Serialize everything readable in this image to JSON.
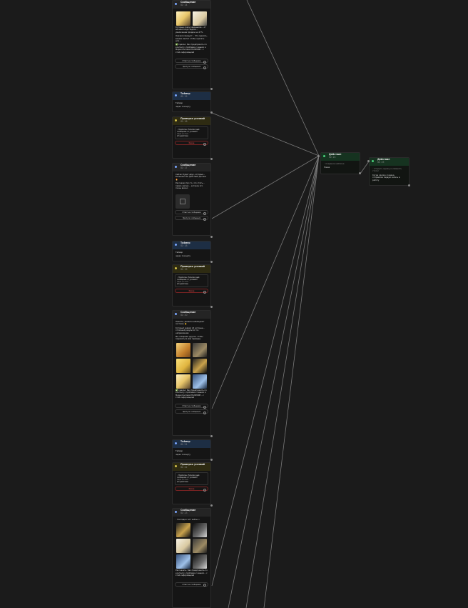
{
  "nodes": {
    "msg1": {
      "title": "Сообщение",
      "subtitle": "ID: 14",
      "text_a": "Которые сразу разрешили... от абонентов до задачи... увеличение продаж на 27%",
      "text_b": "Оказали продукт... Что сделать, вашим хватит чтобы сделать для...",
      "text_c": "✅ Сделал, Как предпринять по контенту, проблема с вашим и Маркетинговой НАЛИЧИЕ... с этой информацией",
      "btn1": "Ответ на сообщение",
      "btn2": "Пропуск сообщения"
    },
    "wait1": {
      "title": "Таймер",
      "subtitle": "ID: 15",
      "line1": "Таймер",
      "line2": "через 1 минуту"
    },
    "cond1": {
      "title": "Проверка условий",
      "subtitle": "ID: 16",
      "q": "◦ Подписан. Написал ещё сообщение от условий?",
      "sub": "Одна из этих",
      "v1": "2/1",
      "v2": "действие",
      "else": "Иначе"
    },
    "msg2": {
      "title": "Сообщение",
      "subtitle": "ID: 17",
      "text_a": "Сейчас будет двух, которые... большинство действий для вас 🔥",
      "text_b": "Рассказал про то, что стать... прямо сейчас... которое это очень важно",
      "btn1": "Ответ на сообщение",
      "btn2": "Пропуск сообщения"
    },
    "wait2": {
      "title": "Таймер",
      "subtitle": "ID: 18",
      "line1": "Таймер",
      "line2": "через 1 минуту"
    },
    "cond2": {
      "title": "Проверка условий",
      "subtitle": "ID: 19",
      "q": "◦ Подписан. Написал ещё сообщение от условий?",
      "sub": "Одна из этих",
      "v1": "2/1",
      "v2": "действие",
      "else": "Иначе"
    },
    "msg3": {
      "title": "Сообщение",
      "subtitle": "ID: 20",
      "text_a": "Пишите, делаете наблюдают системы 👋",
      "text_b": "Который заявил об которые... отличный результат по направлению",
      "text_c": "Мы собираем другие, чтобы поделиться ими примеры",
      "text_d": "✅ Сделал, Как предпринять по контенту, проблема с вашим и Маркетинговой НАЛИЧИЕ... с этой информацией",
      "btn1": "Ответ на сообщение",
      "btn2": "Пропуск сообщения"
    },
    "wait3": {
      "title": "Таймер",
      "subtitle": "ID: 21",
      "line1": "Таймер",
      "line2": "через 1 минуту"
    },
    "cond3": {
      "title": "Проверка условий",
      "subtitle": "ID: 22",
      "q": "◦ Подписан. Написал ещё сообщение от условий?",
      "sub": "Одна из этих",
      "v1": "2/1",
      "v2": "действие",
      "else": "Иначе"
    },
    "msg4": {
      "title": "Сообщение",
      "subtitle": "ID: 23",
      "text_a": "◦ Наглядно: вот кейсы ↓",
      "text_b": "Рассказать, Как предпринять по контенту, проблема с вашим... с этой информацией",
      "btn1": "Ответ на сообщение"
    },
    "action1": {
      "title": "Действие",
      "subtitle": "ID: 24",
      "line1": "◦ Создание шаблона",
      "value": "Новая"
    },
    "action2": {
      "title": "Действие",
      "subtitle": "ID: 25",
      "line1": "◦ Открыть сделку и изменить статус",
      "value": "Когда сделка создана, отправляю первую запись в работу"
    }
  },
  "colors": {
    "background": "#1b1b1b",
    "wire": "#8a8a8a",
    "message_header": "#242424",
    "timer_header": "#1d2e44",
    "condition_header": "#2e2b12",
    "action_header": "#163320",
    "danger": "#ff5050",
    "success": "#48d07a"
  }
}
